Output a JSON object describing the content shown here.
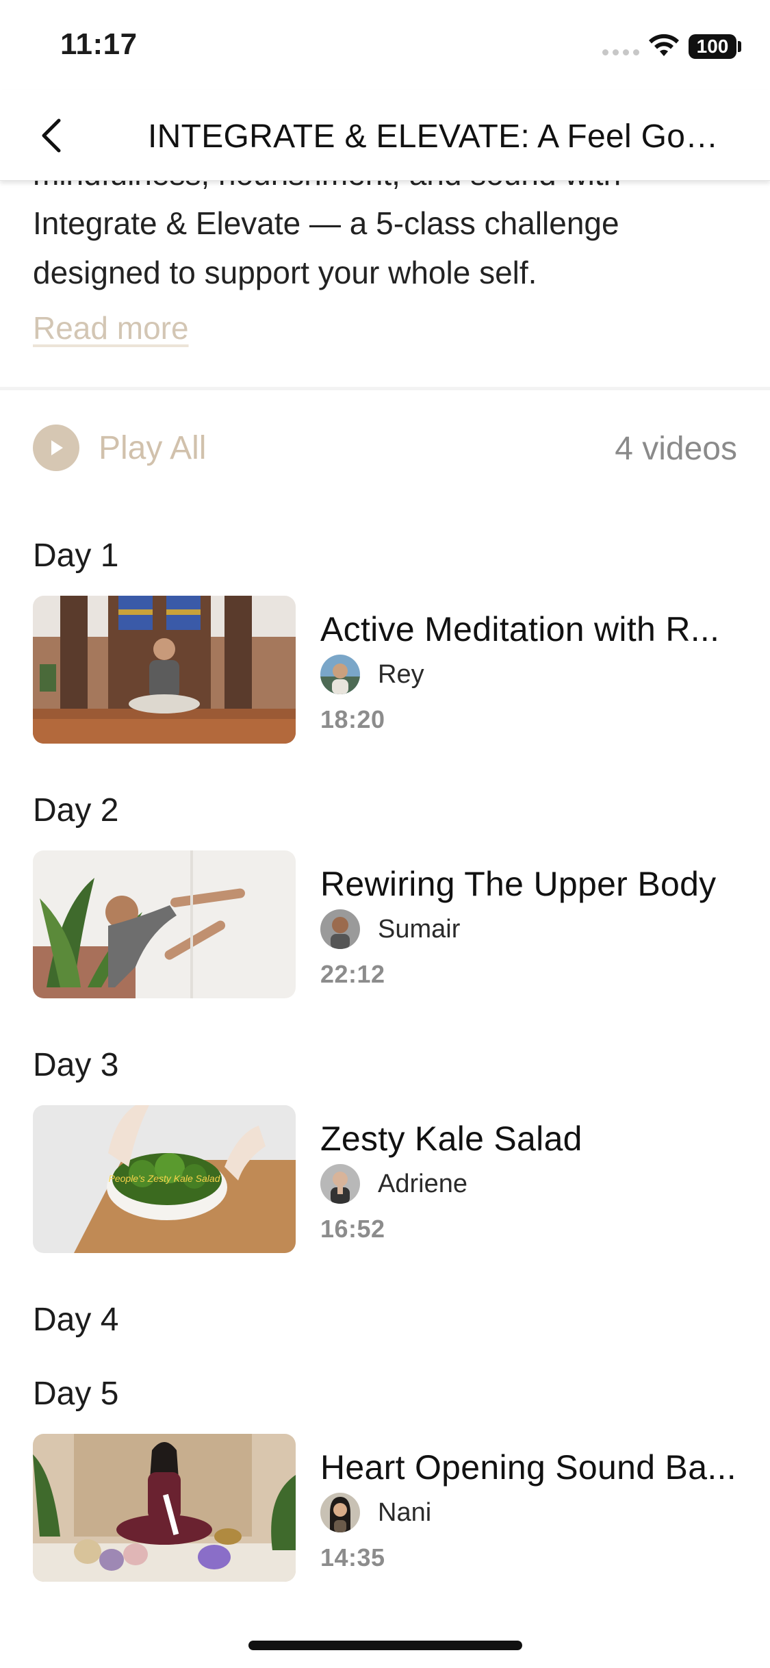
{
  "status_bar": {
    "time": "11:17",
    "battery": "100"
  },
  "header": {
    "title": "INTEGRATE & ELEVATE: A Feel Goo..."
  },
  "description": {
    "text": "mindfulness, nourishment, and sound with Integrate & Elevate — a 5-class challenge designed to support your whole self.",
    "read_more": "Read more"
  },
  "playlist": {
    "play_all": "Play All",
    "count": "4 videos"
  },
  "days": [
    {
      "label": "Day 1",
      "video": {
        "title": "Active Meditation with R...",
        "instructor": "Rey",
        "duration": "18:20"
      }
    },
    {
      "label": "Day 2",
      "video": {
        "title": "Rewiring The Upper Body",
        "instructor": "Sumair",
        "duration": "22:12"
      }
    },
    {
      "label": "Day 3",
      "video": {
        "title": "Zesty Kale Salad",
        "instructor": "Adriene",
        "duration": "16:52",
        "thumbnail_caption": "People's Zesty Kale Salad"
      }
    },
    {
      "label": "Day 4"
    },
    {
      "label": "Day 5",
      "video": {
        "title": "Heart Opening Sound Ba...",
        "instructor": "Nani",
        "duration": "14:35"
      }
    }
  ],
  "colors": {
    "accent": "#d6c7b3",
    "accent_text": "#d1c1ac",
    "muted": "#8c8c8c"
  }
}
